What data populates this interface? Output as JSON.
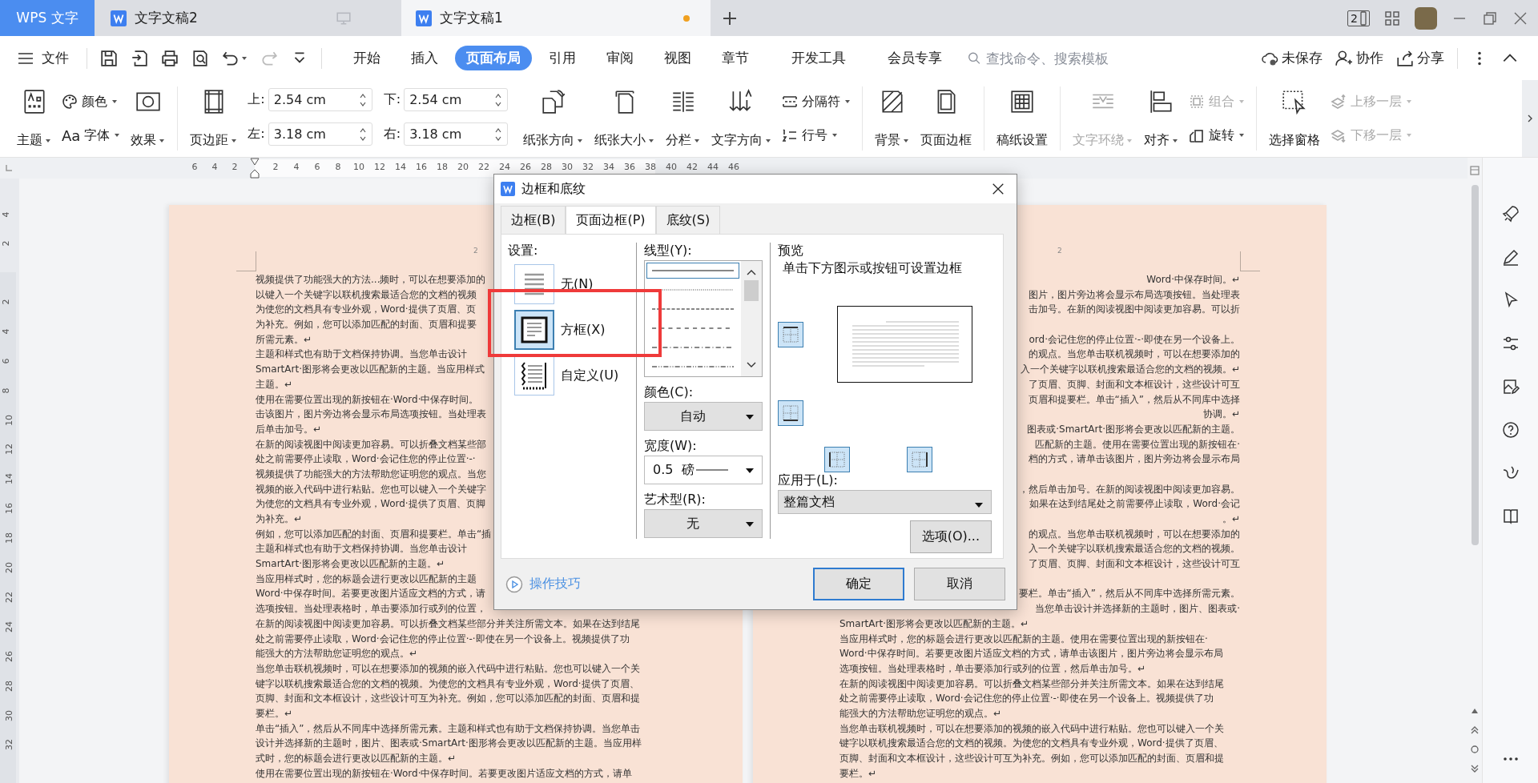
{
  "title_bar": {
    "app_tab": "WPS 文字",
    "tabs": [
      {
        "title": "文字文稿2",
        "selected": false,
        "unsaved": false
      },
      {
        "title": "文字文稿1",
        "selected": true,
        "unsaved": true
      }
    ],
    "window_count": "2"
  },
  "menu_bar": {
    "file_menu": "文件",
    "tabs": [
      {
        "label": "开始",
        "selected": false
      },
      {
        "label": "插入",
        "selected": false
      },
      {
        "label": "页面布局",
        "selected": true
      },
      {
        "label": "引用",
        "selected": false
      },
      {
        "label": "审阅",
        "selected": false
      },
      {
        "label": "视图",
        "selected": false
      },
      {
        "label": "章节",
        "selected": false
      },
      {
        "label": "开发工具",
        "selected": false
      },
      {
        "label": "会员专享",
        "selected": false
      }
    ],
    "search": {
      "placeholder": "查找命令、搜索模板"
    },
    "actions": [
      "未保存",
      "协作",
      "分享"
    ]
  },
  "ribbon": [
    {
      "kind": "large",
      "label": "主题",
      "dropdown": true,
      "disabled": false
    },
    {
      "kind": "stack",
      "items": [
        {
          "label": "颜色",
          "dropdown": true,
          "disabled": false
        },
        {
          "glyph": "Aa",
          "label": "字体",
          "dropdown": true,
          "disabled": false
        }
      ]
    },
    {
      "kind": "large",
      "label": "效果",
      "dropdown": true,
      "disabled": false
    },
    {
      "kind": "divider"
    },
    {
      "kind": "large",
      "label": "页边距",
      "dropdown": true,
      "disabled": false
    },
    {
      "kind": "margins",
      "fields": [
        {
          "label": "上:",
          "value": "2.54 cm"
        },
        {
          "label": "左:",
          "value": "3.18 cm"
        },
        {
          "label": "下:",
          "value": "2.54 cm"
        },
        {
          "label": "右:",
          "value": "3.18 cm"
        }
      ]
    },
    {
      "kind": "large",
      "label": "纸张方向",
      "dropdown": true,
      "disabled": false
    },
    {
      "kind": "large",
      "label": "纸张大小",
      "dropdown": true,
      "disabled": false
    },
    {
      "kind": "large",
      "label": "分栏",
      "dropdown": true,
      "disabled": false
    },
    {
      "kind": "large",
      "label": "文字方向",
      "dropdown": true,
      "disabled": false
    },
    {
      "kind": "stack",
      "items": [
        {
          "label": "分隔符",
          "dropdown": true,
          "disabled": false
        },
        {
          "label": "行号",
          "dropdown": true,
          "disabled": false
        }
      ]
    },
    {
      "kind": "divider"
    },
    {
      "kind": "large",
      "label": "背景",
      "dropdown": true,
      "disabled": false
    },
    {
      "kind": "large",
      "label": "页面边框",
      "dropdown": false,
      "disabled": false
    },
    {
      "kind": "divider"
    },
    {
      "kind": "large",
      "label": "稿纸设置",
      "dropdown": false,
      "disabled": false
    },
    {
      "kind": "divider"
    },
    {
      "kind": "large",
      "label": "文字环绕",
      "dropdown": true,
      "disabled": true
    },
    {
      "kind": "large",
      "label": "对齐",
      "dropdown": true,
      "disabled": false
    },
    {
      "kind": "stack",
      "items": [
        {
          "label": "组合",
          "dropdown": true,
          "disabled": true
        },
        {
          "label": "旋转",
          "dropdown": true,
          "disabled": false
        }
      ]
    },
    {
      "kind": "divider"
    },
    {
      "kind": "large",
      "label": "选择窗格",
      "dropdown": false,
      "disabled": false
    },
    {
      "kind": "stack",
      "items": [
        {
          "label": "上移一层",
          "dropdown": true,
          "disabled": true
        },
        {
          "label": "下移一层",
          "dropdown": true,
          "disabled": true
        }
      ]
    }
  ],
  "rulers": {
    "horizontal": {
      "before_origin": [
        "6",
        "4",
        "2"
      ],
      "after_origin": [
        "2",
        "4",
        "6",
        "8",
        "10",
        "12",
        "14",
        "16",
        "18",
        "20",
        "22",
        "24",
        "26",
        "28",
        "30",
        "32",
        "34",
        "36",
        "38",
        "40",
        "42",
        "44",
        "46"
      ]
    },
    "vertical": {
      "before_origin": [
        "4",
        "2"
      ],
      "after_origin": [
        "2",
        "4",
        "6",
        "8",
        "10",
        "12",
        "14",
        "16",
        "18",
        "20",
        "22",
        "24",
        "26",
        "28",
        "30",
        "32"
      ]
    }
  },
  "pages": [
    {
      "header_mark": "2",
      "lines": [
        "视频提供了功能强大的方法...频时，可以在想要添加的",
        "以键入一个关键字以联机搜索最适合您的文档的视频",
        "为使您的文档具有专业外观，Word·提供了页眉、页",
        "为补充。例如，您可以添加匹配的封面、页眉和提要",
        "所需元素。↵",
        "主题和样式也有助于文档保持协调。当您单击设计",
        "SmartArt·图形将会更改以匹配新的主题。当应用样式",
        "主题。↵",
        "使用在需要位置出现的新按钮在·Word·中保存时间。",
        "击该图片，图片旁边将会显示布局选项按钮。当处理表",
        "后单击加号。↵",
        "在新的阅读视图中阅读更加容易。可以折叠文档某些部",
        "处之前需要停止读取，Word·会记住您的停止位置·-·",
        "视频提供了功能强大的方法帮助您证明您的观点。当您",
        "视频的嵌入代码中进行粘贴。您也可以键入一个关键字",
        "为使您的文档具有专业外观，Word·提供了页眉、页脚",
        "为补充。↵",
        "例如，您可以添加匹配的封面、页眉和提要栏。单击“插",
        "主题和样式也有助于文档保持协调。当您单击设计",
        "SmartArt·图形将会更改以匹配新的主题。↵",
        "当应用样式时，您的标题会进行更改以匹配新的主题",
        "Word·中保存时间。若要更改图片适应文档的方式，请",
        "选项按钮。当处理表格时，单击要添加行或列的位置，",
        "在新的阅读视图中阅读更加容易。可以折叠文档某些部分并关注所需文本。如果在达到结尾",
        "处之前需要停止读取，Word·会记住您的停止位置·-·即使在另一个设备上。视频提供了功",
        "能强大的方法帮助您证明您的观点。↵",
        "当您单击联机视频时，可以在想要添加的视频的嵌入代码中进行粘贴。您也可以键入一个关",
        "键字以联机搜索最适合您的文档的视频。为使您的文档具有专业外观，Word·提供了页眉、",
        "页脚、封面和文本框设计，这些设计可互为补充。例如，您可以添加匹配的封面、页眉和提",
        "要栏。↵",
        "单击“插入”，然后从不同库中选择所需元素。主题和样式也有助于文档保持协调。当您单击",
        "设计并选择新的主题时，图片、图表或·SmartArt·图形将会更改以匹配新的主题。当应用样",
        "式时，您的标题会进行更改以匹配新的主题。↵",
        "使用在需要位置出现的新按钮在·Word·中保存时间。若要更改图片适应文档的方式，请单"
      ]
    },
    {
      "header_mark": "2",
      "clipped_blocks": [
        [
          "Word·中保存时间。↵",
          "图片，图片旁边将会显示布局选项按钮。当处理表",
          "击加号。在新的阅读视图中阅读更加容易。可以折"
        ],
        [
          "ord·会记住您的停止位置·-·即使在另一个设备上。",
          "的观点。当您单击联机视频时，可以在想要添加的",
          "入一个关键字以联机搜索最适合您的文档的视频。↵",
          "了页眉、页脚、封面和文本框设计，这些设计可互",
          "页眉和提要栏。单击“插入”，然后从不同库中选择",
          "协调。↵",
          "图表或·SmartArt·图形将会更改以匹配新的主题。",
          "匹配新的主题。使用在需要位置出现的新按钮在·",
          "档的方式，请单击该图片，图片旁边将会显示布局"
        ],
        [
          "，然后单击加号。在新的阅读视图中阅读更加容易。",
          "如果在达到结尾处之前需要停止读取，Word·会记",
          "。↵",
          "的观点。当您单击联机视频时，可以在想要添加的",
          "入一个关键字以联机搜索最适合您的文档的视频。",
          "了页眉、页脚、封面和文本框设计，这些设计可互"
        ],
        [
          "要栏。单击“插入”，然后从不同库中选择所需元素。",
          "当您单击设计并选择新的主题时，图片、图表或·"
        ]
      ],
      "lines": [
        "SmartArt·图形将会更改以匹配新的主题。↵",
        "当应用样式时，您的标题会进行更改以匹配新的主题。使用在需要位置出现的新按钮在·",
        "Word·中保存时间。若要更改图片适应文档的方式，请单击该图片，图片旁边将会显示布局",
        "选项按钮。当处理表格时，单击要添加行或列的位置，然后单击加号。↵",
        "在新的阅读视图中阅读更加容易。可以折叠文档某些部分并关注所需文本。如果在达到结尾",
        "处之前需要停止读取，Word·会记住您的停止位置·-·即使在另一个设备上。视频提供了功",
        "能强大的方法帮助您证明您的观点。↵",
        "当您单击联机视频时，可以在想要添加的视频的嵌入代码中进行粘贴。您也可以键入一个关",
        "键字以联机搜索最适合您的文档的视频。为使您的文档具有专业外观，Word·提供了页眉、",
        "页脚、封面和文本框设计，这些设计可互为补充。例如，您可以添加匹配的封面、页眉和提",
        "要栏。↵"
      ]
    }
  ],
  "dialog": {
    "title": "边框和底纹",
    "tabs": [
      {
        "label": "边框(B)",
        "selected": false
      },
      {
        "label": "页面边框(P)",
        "selected": true
      },
      {
        "label": "底纹(S)",
        "selected": false
      }
    ],
    "setting": {
      "label": "设置:",
      "options": [
        {
          "kind": "none",
          "label": "无(N)",
          "selected": false
        },
        {
          "kind": "box",
          "label": "方框(X)",
          "selected": true
        },
        {
          "kind": "custom",
          "label": "自定义(U)",
          "selected": false
        }
      ]
    },
    "line_style": {
      "label": "线型(Y):",
      "styles": [
        {
          "kind": "solid",
          "selected": true
        },
        {
          "kind": "dotted",
          "selected": false
        },
        {
          "kind": "dashed",
          "selected": false
        },
        {
          "kind": "wide-dashed",
          "selected": false
        },
        {
          "kind": "dash-dot",
          "selected": false
        },
        {
          "kind": "dash-dot-dot",
          "selected": false
        }
      ]
    },
    "color": {
      "label": "颜色(C):",
      "value": "自动"
    },
    "width": {
      "label": "宽度(W):",
      "value": "0.5  磅"
    },
    "art": {
      "label": "艺术型(R):",
      "value": "无"
    },
    "preview": {
      "label": "预览",
      "hint": "单击下方图示或按钮可设置边框",
      "borders": [
        {
          "kind": "top",
          "on": true
        },
        {
          "kind": "bottom",
          "on": true
        },
        {
          "kind": "left",
          "on": true
        },
        {
          "kind": "right",
          "on": true
        }
      ]
    },
    "apply_to": {
      "label": "应用于(L):",
      "value": "整篇文档"
    },
    "options_button": "选项(O)...",
    "tips_link": "操作技巧",
    "buttons": [
      {
        "label": "确定",
        "default": true
      },
      {
        "label": "取消",
        "default": false
      }
    ]
  }
}
